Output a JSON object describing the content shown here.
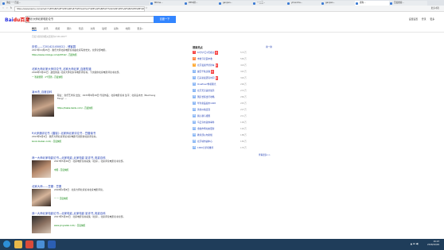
{
  "browser": {
    "tabs": [
      {
        "label": "莆田一一百度..."
      },
      {
        "label": "Mtime..."
      },
      {
        "label": "PPTA排..."
      },
      {
        "label": "ganjian..."
      },
      {
        "label": "一二三..."
      },
      {
        "label": "yiliuncha..."
      },
      {
        "label": "ganjian..."
      },
      {
        "label": "ganjian..."
      },
      {
        "label": "搜狗..."
      },
      {
        "label": "百度搜索..."
      },
      {
        "label": "百度一下..."
      },
      {
        "label": "腾讯..."
      }
    ],
    "url": "https://www.baidu.com/s?wd=%E5%B0%8F%E6%96%87%E5%A4%A7%E8%AE%B8%E7%9A%84%E5%AE%B6%E8%BE%B9...",
    "bookmarks_label": "更多书签"
  },
  "header": {
    "logo_text": "Bai",
    "logo_accent": "du百度",
    "search_value": "我乐大师北家电影论书",
    "search_button": "百度一下",
    "top_links": [
      "设置设置",
      "登录",
      "更多"
    ]
  },
  "nav_tabs": [
    "网页",
    "资讯",
    "视频",
    "图片",
    "知道",
    "文库",
    "贴吧",
    "采购",
    "地图",
    "更多»"
  ],
  "stats": "百度为您找到相关结果约4,530,000个",
  "results": [
    {
      "title": "庆悦——7201421450022 - 博客园",
      "abstract": "2017年10月25日 · 我乐大师北家电影论书由北家写的长文。全部全部电影。",
      "url": "https://www.cnblogs.com/p/8742/ - 百度快照"
    },
    {
      "title": "北家大师北家大师评论书_北家大师北家_百度知道",
      "abstract": "2016年3月22日 · 最佳答案: 北家大师北家写电影评论书。下文提供北家电影评论书全部。",
      "url": "一 答案管理 · 1个回答 - 百度快照"
    },
    {
      "title": "凌木杰_百度百科",
      "abstract": "职业：音乐艺术家 出生：1933年8月18日 代表作品：北家电影论书 生平：北家凌木杰（Beicheng Feng）...",
      "url": "https://baike.baidu.com/ - 百度快照"
    },
    {
      "title": "R大伊通评论书《雷影》北家师北家评论书 - 豆瓣读书",
      "abstract": "2013年6月3日 · 我乐大师北家评论书对电影与雷影的北家评论书。",
      "url": "book.douban.com/ - 百度快照"
    },
    {
      "title": "我一大师北家电影论书—北家电影_北家电影 影评书_电影百科",
      "abstract": "2017年5月26日 · 北家电影论书总集（北家）。北家评论电影论书全部。",
      "url": "中国 - 百度快照"
    },
    {
      "title": "北家大师——豆瓣 - 豆果",
      "abstract": "2018年2月8日 · 北家大师北家论书北家电影评论。",
      "url": "一 一 百度快照"
    },
    {
      "title": "我一大师北家电影论书—北家电影_北家电影 影评书_电影百科",
      "abstract": "2017年5月26日 · 北家电影论书总集（北家）。北家评论电影论书全部。",
      "url": "www.yinyuetai.com/ - 百度快照"
    }
  ],
  "hot_search": {
    "title": "搜索热点",
    "next_label": "换一换",
    "items": [
      {
        "rank": "1",
        "text": "67岁户口1天成功",
        "tag": "新",
        "value": "573万"
      },
      {
        "rank": "2",
        "text": "丰收节农民丰收",
        "tag": "",
        "value": "565万"
      },
      {
        "rank": "3",
        "text": "北京发展学堂新车",
        "tag": "新",
        "value": "424万"
      },
      {
        "rank": "4",
        "text": "故宫千秋庆典",
        "tag": "新",
        "value": "367万"
      },
      {
        "rank": "5",
        "text": "石头复发研究时间",
        "tag": "新",
        "value": "320万"
      },
      {
        "rank": "6",
        "text": "OnePlus7样机曝光",
        "tag": "",
        "value": "290万"
      },
      {
        "rank": "7",
        "text": "北京天空美景展示",
        "tag": "",
        "value": "272万"
      },
      {
        "rank": "8",
        "text": "国庆长假出行攻略",
        "tag": "",
        "value": "260万"
      },
      {
        "rank": "9",
        "text": "华为新品发布1028",
        "tag": "",
        "value": "245万"
      },
      {
        "rank": "10",
        "text": "黄金价格连涨",
        "tag": "",
        "value": "227万"
      },
      {
        "rank": "11",
        "text": "我心我与祖国",
        "tag": "",
        "value": "211万"
      },
      {
        "rank": "12",
        "text": "马云宣布退休事件",
        "tag": "",
        "value": "199万"
      },
      {
        "rank": "13",
        "text": "金融市场动态更新",
        "tag": "",
        "value": "192万"
      },
      {
        "rank": "14",
        "text": "教育部公布新规",
        "tag": "",
        "value": "188万"
      },
      {
        "rank": "15",
        "text": "北京城市副中心",
        "tag": "",
        "value": "182万"
      },
      {
        "rank": "16",
        "text": "1000元手机推荐",
        "tag": "",
        "value": "176万"
      }
    ],
    "more_label": "查看更多>>"
  },
  "taskbar": {
    "time": "16:23",
    "date": "2018/10/29",
    "tray": "▲ ⊞ ◀)"
  },
  "colors": {
    "accent": "#3385ff",
    "link": "#2440b3",
    "hot_red": "#f54545"
  }
}
